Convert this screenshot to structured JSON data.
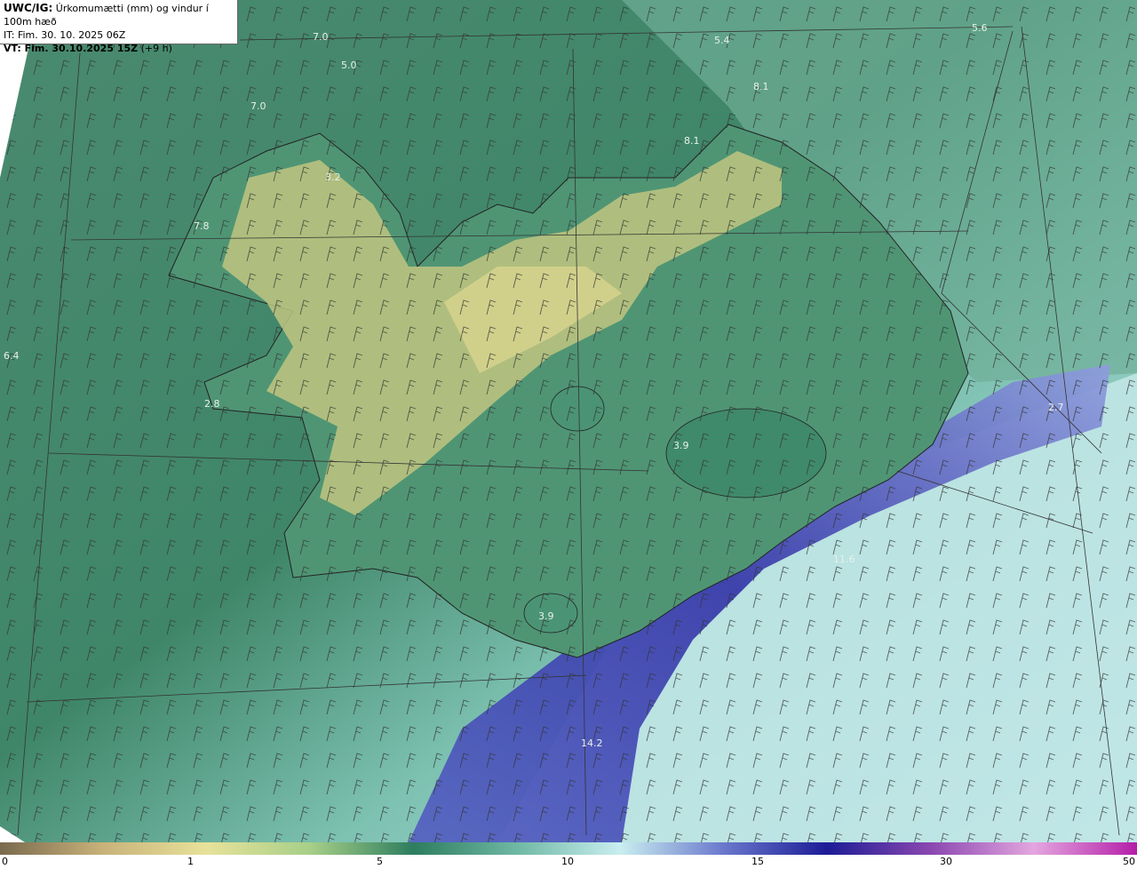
{
  "header": {
    "code": "UWC/IG:",
    "title": "Úrkomumætti (mm) og vindur í 100m hæð",
    "it_line": "IT: Fim. 30. 10. 2025 06Z",
    "vt_label": "VT: Fim. 30.10.2025 15Z",
    "vt_offset": "(+9 h)"
  },
  "map_labels": [
    {
      "text": "7.0"
    },
    {
      "text": "5.0"
    },
    {
      "text": "7.0"
    },
    {
      "text": "5.4"
    },
    {
      "text": "5.6"
    },
    {
      "text": "8.1"
    },
    {
      "text": "8.1"
    },
    {
      "text": "3.2"
    },
    {
      "text": "7.8"
    },
    {
      "text": "6.4"
    },
    {
      "text": "2.8"
    },
    {
      "text": "3.9"
    },
    {
      "text": "2.7"
    },
    {
      "text": "3.9"
    },
    {
      "text": "11.6"
    },
    {
      "text": "14.2"
    }
  ],
  "legend": {
    "ticks": [
      "0",
      "1",
      "5",
      "10",
      "15",
      "30",
      "50"
    ],
    "colors": [
      "#7a6a4e",
      "#c9b27a",
      "#e7e29a",
      "#a7cf88",
      "#2d7d5f",
      "#6fb8a4",
      "#c9eef0",
      "#6a78cc",
      "#1c1c96",
      "#8a47b0",
      "#e4a6df",
      "#b41ea8"
    ]
  },
  "colors": {
    "low": "#4e8f74",
    "land_dry": "#c8cc86",
    "high_sea": "#bfe6e8",
    "heavy": "#3a3cae"
  }
}
